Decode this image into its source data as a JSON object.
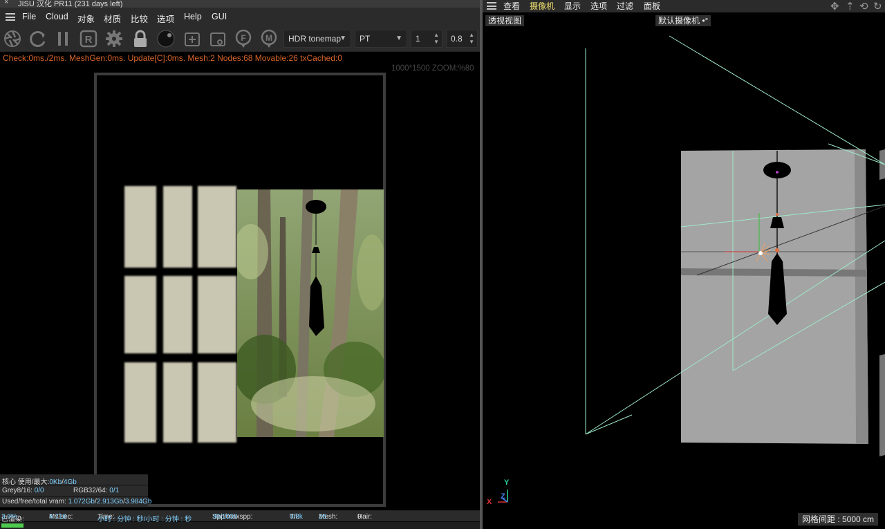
{
  "app": {
    "title": "JISU 汉化 PR11 (231 days left)",
    "close_glyph": "×"
  },
  "menu": {
    "items": [
      "File",
      "Cloud",
      "对象",
      "材质",
      "比较",
      "选项",
      "Help",
      "GUI"
    ]
  },
  "toolbar": {
    "icons": [
      "aperture-icon",
      "refresh-icon",
      "pause-icon",
      "render-r-icon",
      "gear-icon",
      "lock-icon",
      "sphere-icon",
      "add-node-icon",
      "node-icon",
      "focus-f-icon",
      "material-m-icon"
    ],
    "r_label": "R",
    "f_label": "F",
    "m_label": "M",
    "tonemap": "HDR tonemap",
    "kernel": "PT",
    "value1": "1",
    "value2": "0.8"
  },
  "stats_line": "Check:0ms./2ms. MeshGen:0ms. Update[C]:0ms. Mesh:2 Nodes:68 Movable:26 txCached:0",
  "zoom_info": "1000*1500 ZOOM:%80",
  "memory": {
    "core_label": "核心 使用/最大:",
    "core_used": "0Kb",
    "core_sep": "/",
    "core_max": "4Gb",
    "grey_label": "Grey8/16:",
    "grey_value": "0/0",
    "rgb_label": "RGB32/64:",
    "rgb_value": "0/1",
    "vram_label": "Used/free/total vram:",
    "vram_used": "1.072Gb",
    "vram_free": "2.913Gb",
    "vram_total": "3.984Gb"
  },
  "status": {
    "rendered_label": "已渲染:",
    "rendered_value": "3.9%",
    "ms_label": "Ms/sec:",
    "ms_value": "4.716",
    "time_label": "Time:",
    "time_value": "小时 : 分钟 : 秒/小时 : 分钟 : 秒",
    "spp_label": "Spp/maxspp:",
    "spp_value": "39/1000",
    "tri_label": "Tri:",
    "tri_value": "0/8k",
    "mesh_label": "Mesh:",
    "mesh_value": "25",
    "hair_label": "Hair:",
    "hair_value": "0",
    "progress_fraction": 0.039
  },
  "viewport": {
    "menu": [
      "查看",
      "摄像机",
      "显示",
      "选项",
      "过滤",
      "面板"
    ],
    "active_menu": "选项",
    "nav_icons": [
      "move-icon",
      "dolly-icon",
      "rotate-icon",
      "reset-icon"
    ],
    "nav_glyphs": [
      "✥",
      "⇡",
      "⟲",
      "↻"
    ],
    "view_label": "透视视图",
    "camera_label": "默认摄像机",
    "grid_info": "网格间距 : 5000 cm",
    "axis_labels": {
      "x": "X",
      "y": "Y",
      "z": "Z"
    }
  },
  "colors": {
    "stats_text": "#d9652b",
    "highlight_value": "#7fd0ff",
    "active_menu": "#f0e070",
    "progress": "#4ecb4e",
    "camera_lines": "#9fe8c8"
  }
}
